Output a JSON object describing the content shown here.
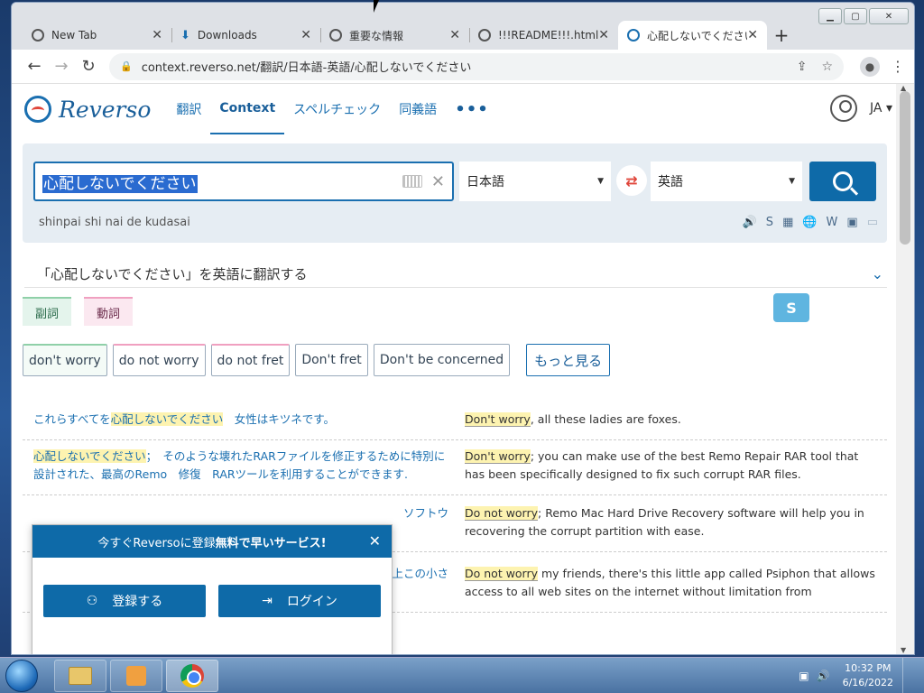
{
  "browser": {
    "tabs": [
      {
        "title": "New Tab",
        "icon": "chrome-icon",
        "active": false
      },
      {
        "title": "Downloads",
        "icon": "download-icon",
        "active": false
      },
      {
        "title": "重要な情報",
        "icon": "globe-icon",
        "active": false
      },
      {
        "title": "!!!README!!!.html",
        "icon": "globe-icon",
        "active": false
      },
      {
        "title": "心配しないでください",
        "icon": "reverso-icon",
        "active": true
      }
    ],
    "url": "context.reverso.net/翻訳/日本語-英語/心配しないでください"
  },
  "reverso": {
    "logo": "Reverso",
    "nav": [
      {
        "label": "翻訳",
        "active": false
      },
      {
        "label": "Context",
        "active": true
      },
      {
        "label": "スペルチェック",
        "active": false
      },
      {
        "label": "同義語",
        "active": false
      }
    ],
    "nav_more": "•••",
    "ui_lang": "JA",
    "search": {
      "query": "心配しないでください",
      "romaji": "shinpai shi nai de kudasai",
      "source_lang": "日本語",
      "target_lang": "英語"
    },
    "tools": [
      "🔊",
      "S",
      "▦",
      "🌐",
      "W",
      "▣",
      "▭"
    ],
    "translate_heading": "「心配しないでください」を英語に翻訳する",
    "pos_tags": [
      {
        "label": "副詞",
        "type": "adv"
      },
      {
        "label": "動詞",
        "type": "verb"
      }
    ],
    "chips": [
      {
        "label": "don't worry",
        "type": "adv"
      },
      {
        "label": "do not worry",
        "type": "verb"
      },
      {
        "label": "do not fret",
        "type": "verb"
      },
      {
        "label": "Don't fret",
        "type": "plain"
      },
      {
        "label": "Don't be concerned",
        "type": "plain"
      }
    ],
    "more_label": "もっと見る",
    "examples": [
      {
        "src_pre": "これらすべてを",
        "src_hl": "心配しないでください",
        "src_post": "　女性はキツネです。",
        "tgt_hl": "Don't worry",
        "tgt_post": ", all these ladies are foxes."
      },
      {
        "src_pre": "",
        "src_hl": "心配しないでください",
        "src_post": "；　そのような壊れたRARファイルを修正するために特別に設計された、最高のRemo　修復　RARツールを利用することができます.",
        "tgt_hl": "Don't worry",
        "tgt_post": "; you can make use of the best Remo Repair RAR tool that has been specifically designed to fix such corrupt RAR files."
      },
      {
        "src_pre": "",
        "src_hl": "",
        "src_post": "ソフトウ",
        "tgt_hl": "Do not worry",
        "tgt_post": "; Remo Mac Hard Drive Recovery software will help you in recovering the corrupt partition with ease."
      },
      {
        "src_pre": "",
        "src_hl": "",
        "src_post": "ネット上この小さ",
        "tgt_hl": "Do not worry",
        "tgt_post": " my friends, there's this little app called Psiphon that allows access to all web sites on the internet without limitation from"
      }
    ],
    "popup": {
      "title_pre": "今すぐReversoに登録 ",
      "title_bold": "無料で早いサービス!",
      "register": "登録する",
      "login": "ログイン"
    }
  },
  "taskbar": {
    "time": "10:32 PM",
    "date": "6/16/2022"
  }
}
